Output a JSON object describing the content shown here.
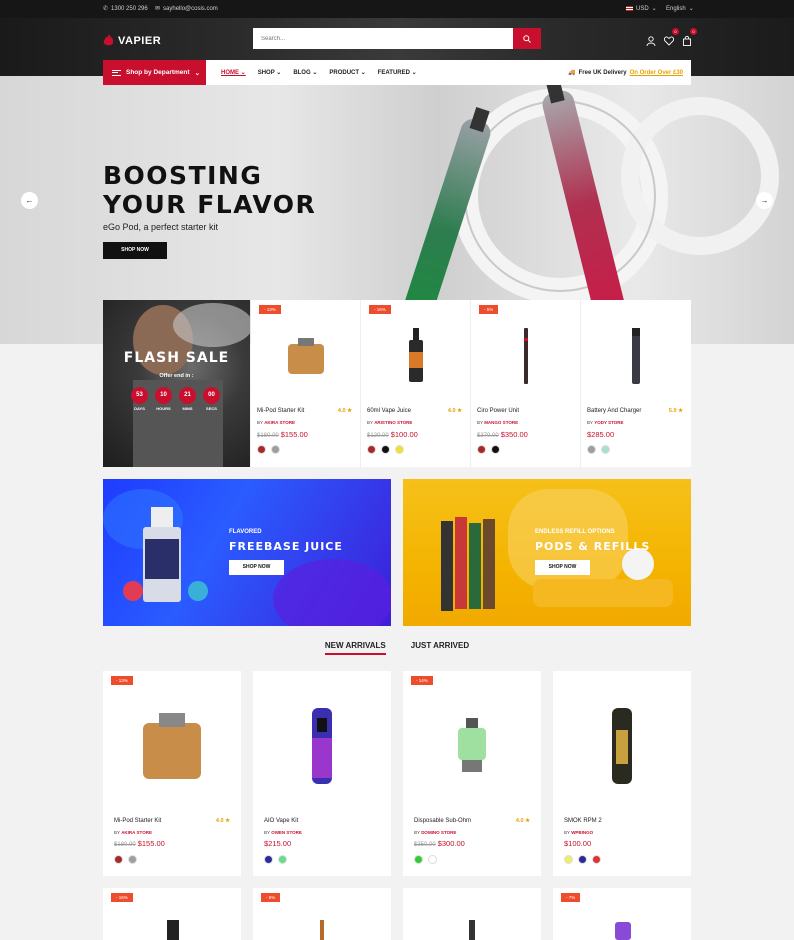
{
  "topbar": {
    "phone": "1300 250 296",
    "email": "sayhello@cosis.com",
    "currency": "USD",
    "language": "English"
  },
  "header": {
    "logo_text": "VAPIER",
    "search_placeholder": "Search...",
    "wishlist_count": "0",
    "cart_count": "0"
  },
  "nav": {
    "department_label": "Shop by Department",
    "links": [
      "HOME",
      "SHOP",
      "BLOG",
      "PRODUCT",
      "FEATURED"
    ],
    "delivery_text": "Free UK Delivery",
    "delivery_link": "On Order Over £30"
  },
  "hero": {
    "title_line1": "BOOSTING",
    "title_line2": "YOUR FLAVOR",
    "subtitle": "eGo Pod, a perfect starter kit",
    "button": "SHOP NOW"
  },
  "flash_sale": {
    "title": "FLASH SALE",
    "offer_text": "Offer end in :",
    "timer": [
      {
        "value": "53",
        "label": "DAYS"
      },
      {
        "value": "10",
        "label": "HOURS"
      },
      {
        "value": "21",
        "label": "MINS"
      },
      {
        "value": "00",
        "label": "SECS"
      }
    ]
  },
  "flash_products": [
    {
      "discount": "- 13%",
      "name": "Mi-Pod Starter Kit",
      "rating": "4.0 ★",
      "store_prefix": "BY",
      "store": "AKIRA STORE",
      "old_price": "$180.00",
      "price": "$155.00",
      "swatches": [
        "#a52a2a",
        "#9e9e9e"
      ]
    },
    {
      "discount": "- 16%",
      "name": "60ml Vape Juice",
      "rating": "4.0 ★",
      "store_prefix": "BY",
      "store": "ARISTINO STORE",
      "old_price": "$120.00",
      "price": "$100.00",
      "swatches": [
        "#a52a2a",
        "#111111",
        "#f0e030"
      ]
    },
    {
      "discount": "- 5%",
      "name": "Ciro Power Unit",
      "rating": "",
      "store_prefix": "BY",
      "store": "MANGO STORE",
      "old_price": "$370.00",
      "price": "$350.00",
      "swatches": [
        "#a52a2a",
        "#111111"
      ]
    },
    {
      "discount": "",
      "name": "Battery And Charger",
      "rating": "5.0 ★",
      "store_prefix": "BY",
      "store": "YODY STORE",
      "old_price": "",
      "price": "$285.00",
      "swatches": [
        "#9e9e9e",
        "#a8e0d0"
      ]
    }
  ],
  "banners": [
    {
      "tag": "FLAVORED",
      "title": "FREEBASE JUICE",
      "button": "SHOP NOW"
    },
    {
      "tag": "ENDLESS REFILL OPTIONS",
      "title": "PODS & REFILLS",
      "button": "SHOP NOW"
    }
  ],
  "tabs": [
    "NEW ARRIVALS",
    "JUST ARRIVED"
  ],
  "arrivals": [
    {
      "discount": "- 13%",
      "name": "Mi-Pod Starter Kit",
      "rating": "4.0 ★",
      "store_prefix": "BY",
      "store": "AKIRA STORE",
      "old_price": "$180.00",
      "price": "$155.00",
      "swatches": [
        "#a52a2a",
        "#9e9e9e"
      ]
    },
    {
      "discount": "",
      "name": "AIO Vape Kit",
      "rating": "",
      "store_prefix": "BY",
      "store": "OWEN STORE",
      "old_price": "",
      "price": "$215.00",
      "swatches": [
        "#2b2b9e",
        "#66dd88"
      ]
    },
    {
      "discount": "- 14%",
      "name": "Disposable Sub-Ohm",
      "rating": "4.0 ★",
      "store_prefix": "BY",
      "store": "DOMINO STORE",
      "old_price": "$350.00",
      "price": "$300.00",
      "swatches": [
        "#33cc33",
        "#ffffff"
      ]
    },
    {
      "discount": "",
      "name": "SMOK RPM 2",
      "rating": "",
      "store_prefix": "BY",
      "store": "WPBINGO",
      "old_price": "",
      "price": "$100.00",
      "swatches": [
        "#eeee66",
        "#2b2b9e",
        "#dd3333"
      ]
    }
  ],
  "bottom_discounts": [
    "- 16%",
    "- 5%",
    "",
    "- 7%"
  ]
}
